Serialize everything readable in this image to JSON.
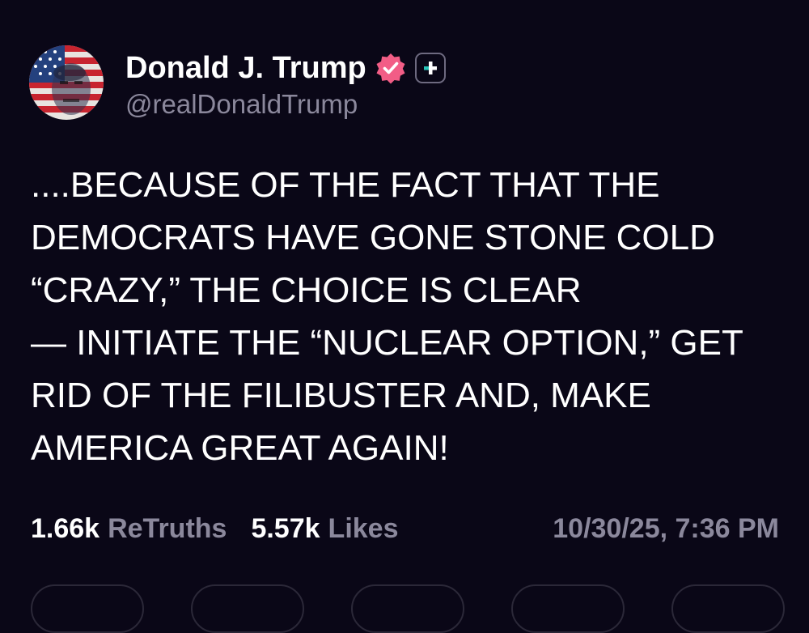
{
  "account": {
    "display_name": "Donald J. Trump",
    "handle": "@realDonaldTrump",
    "verified_icon": "verified-badge-icon",
    "plus_icon": "plus-badge-icon"
  },
  "post": {
    "text": "....BECAUSE OF THE FACT THAT THE\nDEMOCRATS HAVE GONE STONE COLD\n“CRAZY,” THE CHOICE IS CLEAR\n— INITIATE THE “NUCLEAR OPTION,” GET\nRID OF THE FILIBUSTER AND, MAKE\nAMERICA GREAT AGAIN!"
  },
  "stats": {
    "retruths_count": "1.66k",
    "retruths_label": "ReTruths",
    "likes_count": "5.57k",
    "likes_label": "Likes",
    "timestamp": "10/30/25, 7:36 PM"
  },
  "colors": {
    "background": "#0a0717",
    "text": "#ffffff",
    "muted": "#8b889c",
    "verified": "#f25d86"
  }
}
